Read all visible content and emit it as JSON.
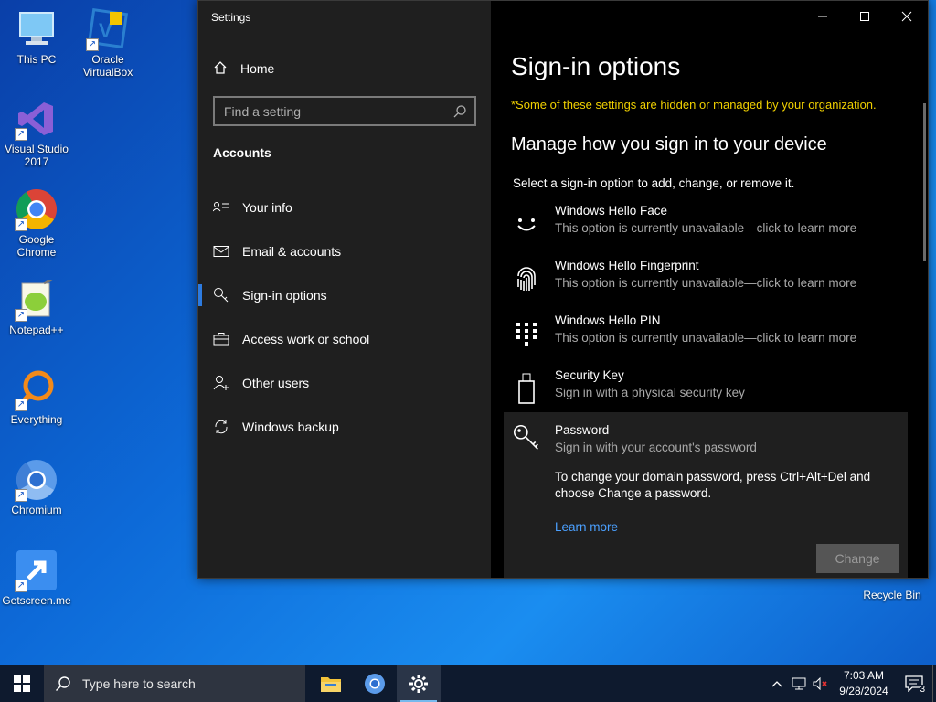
{
  "desktop": {
    "icons": [
      {
        "label": "This PC"
      },
      {
        "label": "Oracle VirtualBox"
      },
      {
        "label": "Visual Studio 2017"
      },
      {
        "label": "Google Chrome"
      },
      {
        "label": "Notepad++"
      },
      {
        "label": "Everything"
      },
      {
        "label": "Chromium"
      },
      {
        "label": "Getscreen.me"
      }
    ],
    "recycle_bin": "Recycle Bin"
  },
  "window": {
    "title": "Settings",
    "home_label": "Home",
    "search_placeholder": "Find a setting",
    "section": "Accounts",
    "nav": [
      {
        "label": "Your info",
        "icon": "person-card-icon"
      },
      {
        "label": "Email & accounts",
        "icon": "mail-icon"
      },
      {
        "label": "Sign-in options",
        "icon": "key-icon"
      },
      {
        "label": "Access work or school",
        "icon": "briefcase-icon"
      },
      {
        "label": "Other users",
        "icon": "add-person-icon"
      },
      {
        "label": "Windows backup",
        "icon": "sync-icon"
      }
    ],
    "active_nav": "Sign-in options"
  },
  "main": {
    "title": "Sign-in options",
    "notice": "*Some of these settings are hidden or managed by your organization.",
    "subheading": "Manage how you sign in to your device",
    "instruction": "Select a sign-in option to add, change, or remove it.",
    "options": [
      {
        "title": "Windows Hello Face",
        "desc": "This option is currently unavailable—click to learn more"
      },
      {
        "title": "Windows Hello Fingerprint",
        "desc": "This option is currently unavailable—click to learn more"
      },
      {
        "title": "Windows Hello PIN",
        "desc": "This option is currently unavailable—click to learn more"
      },
      {
        "title": "Security Key",
        "desc": "Sign in with a physical security key"
      },
      {
        "title": "Password",
        "desc": "Sign in with your account's password"
      }
    ],
    "password_info": "To change your domain password, press Ctrl+Alt+Del and choose Change a password.",
    "learn_more": "Learn more",
    "change_button": "Change"
  },
  "taskbar": {
    "search_placeholder": "Type here to search",
    "time": "7:03 AM",
    "date": "9/28/2024",
    "notification_count": "3"
  },
  "colors": {
    "accent": "#2d7be0",
    "notice": "#f0d000",
    "link": "#4ba0ff"
  }
}
